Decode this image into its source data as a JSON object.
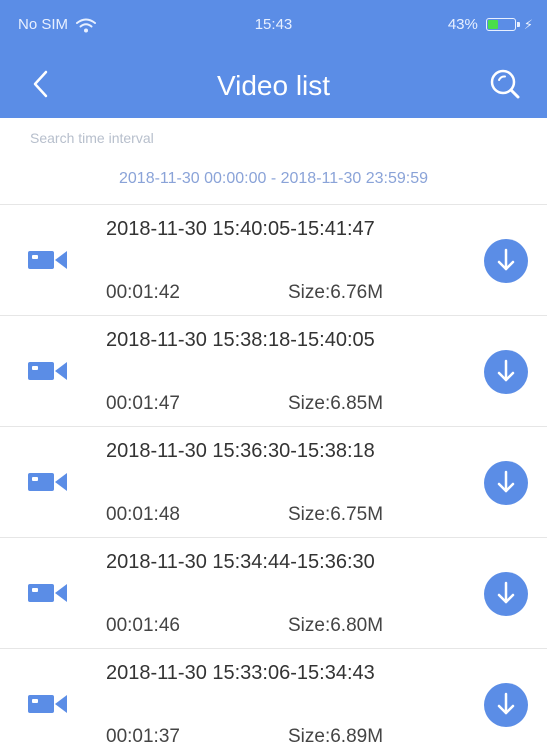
{
  "status_bar": {
    "carrier": "No SIM",
    "time": "15:43",
    "battery": "43%",
    "battery_level_percent": 43
  },
  "nav": {
    "title": "Video list",
    "back_icon": "chevron-left-icon",
    "search_icon": "search-icon"
  },
  "search": {
    "interval_label": "Search time interval",
    "interval_value": "2018-11-30 00:00:00 - 2018-11-30 23:59:59"
  },
  "videos": [
    {
      "time_range": "2018-11-30 15:40:05-15:41:47",
      "duration": "00:01:42",
      "size": "Size:6.76M"
    },
    {
      "time_range": "2018-11-30 15:38:18-15:40:05",
      "duration": "00:01:47",
      "size": "Size:6.85M"
    },
    {
      "time_range": "2018-11-30 15:36:30-15:38:18",
      "duration": "00:01:48",
      "size": "Size:6.75M"
    },
    {
      "time_range": "2018-11-30 15:34:44-15:36:30",
      "duration": "00:01:46",
      "size": "Size:6.80M"
    },
    {
      "time_range": "2018-11-30 15:33:06-15:34:43",
      "duration": "00:01:37",
      "size": "Size:6.89M"
    }
  ],
  "colors": {
    "accent": "#5b8de6",
    "battery": "#4ade4a"
  }
}
